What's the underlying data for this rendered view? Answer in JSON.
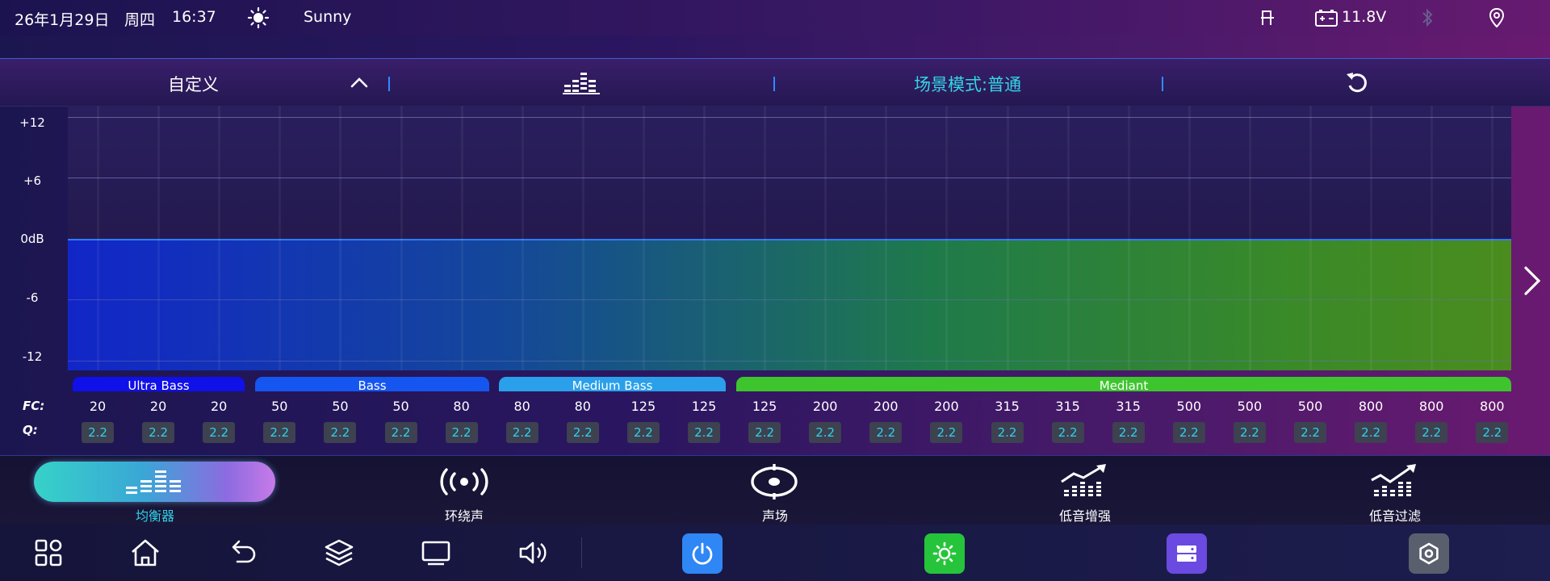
{
  "status": {
    "date": "26年1月29日",
    "weekday": "周四",
    "time": "16:37",
    "weather": "Sunny",
    "voltage": "11.8V"
  },
  "header": {
    "preset": "自定义",
    "scene": "场景模式:普通"
  },
  "colors": {
    "accent": "#2fd1e6",
    "scene_text": "#33d6e6",
    "fill_start": "#1226c8",
    "fill_end": "#4a8c1e"
  },
  "eq": {
    "y_labels": [
      "+12",
      "+6",
      "0dB",
      "-6",
      "-12"
    ],
    "groups": [
      "Ultra Bass",
      "Bass",
      "Medium Bass",
      "Mediant"
    ],
    "fc_label": "FC:",
    "q_label": "Q:",
    "fc": [
      "20",
      "20",
      "20",
      "50",
      "50",
      "50",
      "80",
      "80",
      "80",
      "125",
      "125",
      "125",
      "200",
      "200",
      "200",
      "315",
      "315",
      "315",
      "500",
      "500",
      "500",
      "800",
      "800",
      "800"
    ],
    "q": [
      "2.2",
      "2.2",
      "2.2",
      "2.2",
      "2.2",
      "2.2",
      "2.2",
      "2.2",
      "2.2",
      "2.2",
      "2.2",
      "2.2",
      "2.2",
      "2.2",
      "2.2",
      "2.2",
      "2.2",
      "2.2",
      "2.2",
      "2.2",
      "2.2",
      "2.2",
      "2.2",
      "2.2"
    ],
    "gain_db": [
      0,
      0,
      0,
      0,
      0,
      0,
      0,
      0,
      0,
      0,
      0,
      0,
      0,
      0,
      0,
      0,
      0,
      0,
      0,
      0,
      0,
      0,
      0,
      0
    ]
  },
  "tabs": [
    {
      "label": "均衡器",
      "icon": "equalizer-icon",
      "active": true
    },
    {
      "label": "环绕声",
      "icon": "surround-icon",
      "active": false
    },
    {
      "label": "声场",
      "icon": "sound-field-icon",
      "active": false
    },
    {
      "label": "低音增强",
      "icon": "bass-boost-icon",
      "active": false
    },
    {
      "label": "低音过滤",
      "icon": "bass-filter-icon",
      "active": false
    }
  ]
}
